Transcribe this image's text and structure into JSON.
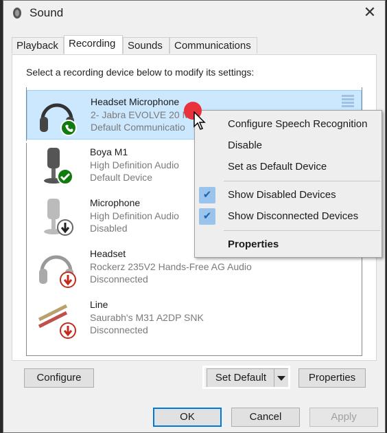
{
  "window": {
    "title": "Sound",
    "close_symbol": "✕"
  },
  "tabs": [
    {
      "label": "Playback"
    },
    {
      "label": "Recording"
    },
    {
      "label": "Sounds"
    },
    {
      "label": "Communications"
    }
  ],
  "instruction": "Select a recording device below to modify its settings:",
  "devices": [
    {
      "name": "Headset Microphone",
      "sub": "2- Jabra EVOLVE 20 M",
      "status": "Default Communicatio",
      "icon": "headset-phone-icon"
    },
    {
      "name": "Boya M1",
      "sub": "High Definition Audio",
      "status": "Default Device",
      "icon": "microphone-check-icon"
    },
    {
      "name": "Microphone",
      "sub": "High Definition Audio",
      "status": "Disabled",
      "icon": "microphone-disabled-icon"
    },
    {
      "name": "Headset",
      "sub": "Rockerz 235V2 Hands-Free AG Audio",
      "status": "Disconnected",
      "icon": "headset-disconnected-icon"
    },
    {
      "name": "Line",
      "sub": "Saurabh's M31 A2DP SNK",
      "status": "Disconnected",
      "icon": "line-in-disconnected-icon"
    }
  ],
  "context_menu": {
    "configure_speech": "Configure Speech Recognition",
    "disable": "Disable",
    "set_default": "Set as Default Device",
    "show_disabled": "Show Disabled Devices",
    "show_disconnected": "Show Disconnected Devices",
    "properties": "Properties",
    "check_symbol": "✔"
  },
  "buttons": {
    "configure": "Configure",
    "set_default": "Set Default",
    "properties": "Properties",
    "ok": "OK",
    "cancel": "Cancel",
    "apply": "Apply"
  },
  "colors": {
    "selection": "#cce8ff",
    "accent": "#0078d7",
    "check_bg": "#9bc4ec",
    "green_badge": "#107c10",
    "red_badge": "#c42b1c"
  }
}
